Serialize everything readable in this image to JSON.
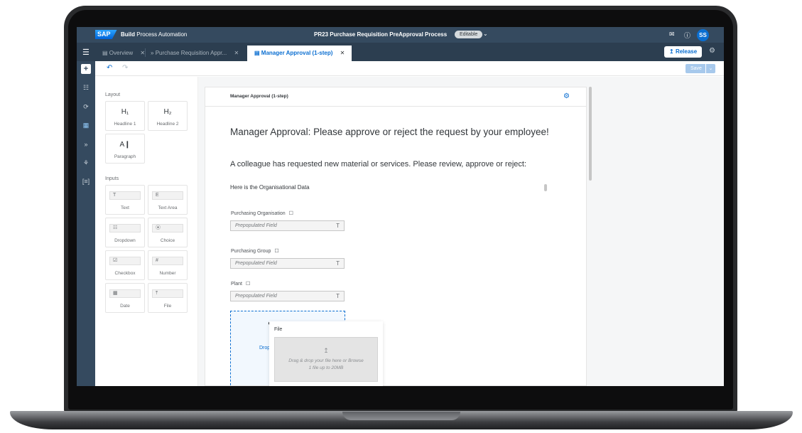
{
  "shellbar": {
    "logo": "SAP",
    "app_name_bold": "Build",
    "app_name_rest": "Process Automation",
    "process_title": "PR23 Purchase Requisition PreApproval Process",
    "status_badge": "Editable",
    "avatar_initials": "SS",
    "icons": [
      "feedback-icon",
      "help-icon"
    ]
  },
  "tabs": [
    {
      "label": "Overview",
      "icon": "document-icon"
    },
    {
      "label": "Purchase Requisition Appr...",
      "icon": "process-icon"
    },
    {
      "label": "Manager Approval (1-step)",
      "icon": "form-icon",
      "active": true
    }
  ],
  "toolbar": {
    "release_label": "Release",
    "save_label": "Save"
  },
  "palette": {
    "layout_heading": "Layout",
    "layout_items": [
      {
        "glyph": "H₁",
        "label": "Headline 1"
      },
      {
        "glyph": "H₂",
        "label": "Headline 2"
      },
      {
        "glyph": "A❙",
        "label": "Paragraph"
      }
    ],
    "inputs_heading": "Inputs",
    "input_items": [
      {
        "glyph": "T",
        "label": "Text"
      },
      {
        "glyph": "E",
        "label": "Text Area"
      },
      {
        "glyph": "☷",
        "label": "Dropdown"
      },
      {
        "glyph": "⦿",
        "label": "Choice"
      },
      {
        "glyph": "☑",
        "label": "Checkbox"
      },
      {
        "glyph": "#",
        "label": "Number"
      },
      {
        "glyph": "▦",
        "label": "Date"
      },
      {
        "glyph": "⤒",
        "label": "File"
      }
    ]
  },
  "form": {
    "card_title": "Manager Approval (1-step)",
    "headline1": "Manager Approval: Please approve or reject the request by your employee!",
    "headline2": "A colleague has requested new material or services. Please review, approve or reject:",
    "paragraph": "Here is the Organisational Data",
    "fields": [
      {
        "label": "Purchasing Organisation",
        "placeholder": "Prepopulated Field",
        "type_icon": "T"
      },
      {
        "label": "Purchasing Group",
        "placeholder": "Prepopulated Field",
        "type_icon": "T"
      },
      {
        "label": "Plant",
        "placeholder": "Prepopulated Field",
        "type_icon": "T"
      }
    ],
    "drop_text": "Drop"
  },
  "drag_preview": {
    "label": "File",
    "upload_line1": "Drag & drop your file here or Browse",
    "upload_line2": "1 file up to 20MB"
  }
}
